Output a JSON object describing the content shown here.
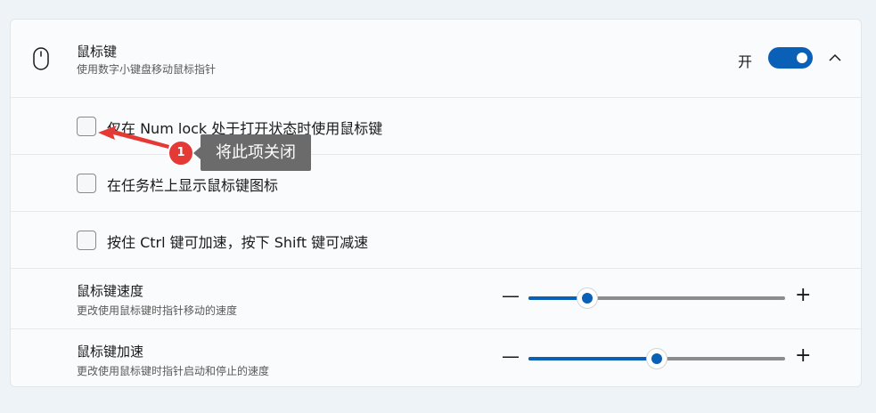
{
  "header": {
    "title": "鼠标键",
    "subtitle": "使用数字小键盘移动鼠标指针",
    "toggle_label": "开",
    "toggle_on": true,
    "icon": "mouse-icon",
    "expand_icon": "chevron-up-icon"
  },
  "options": [
    {
      "label": "仅在 Num lock 处于打开状态时使用鼠标键",
      "checked": false
    },
    {
      "label": "在任务栏上显示鼠标键图标",
      "checked": false
    },
    {
      "label": "按住 Ctrl 键可加速，按下 Shift 键可减速",
      "checked": false
    }
  ],
  "speed": {
    "title": "鼠标键速度",
    "subtitle": "更改使用鼠标键时指针移动的速度",
    "minus": "—",
    "plus": "+",
    "value_percent": 23
  },
  "acceleration": {
    "title": "鼠标键加速",
    "subtitle": "更改使用鼠标键时指针启动和停止的速度",
    "minus": "—",
    "plus": "+",
    "value_percent": 50
  },
  "annotation": {
    "badge": "1",
    "tooltip": "将此项关闭"
  },
  "colors": {
    "accent": "#0a60b6",
    "badge": "#e53935",
    "tooltip_bg": "#6b6b6b"
  }
}
